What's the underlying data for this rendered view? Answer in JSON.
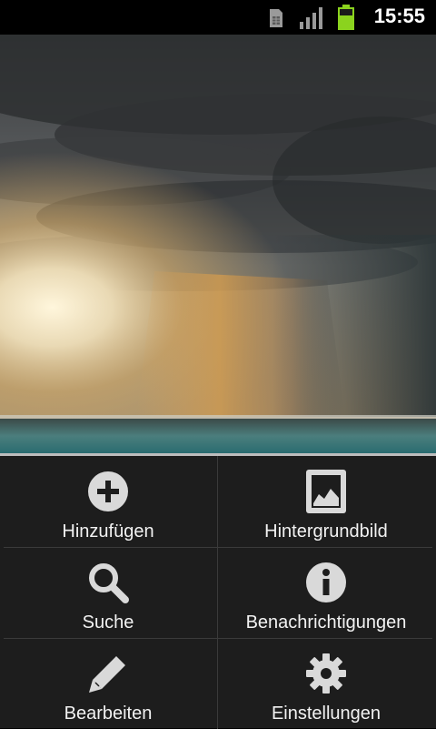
{
  "status_bar": {
    "time": "15:55",
    "icons": [
      "sim-card-icon",
      "signal-strength-icon",
      "battery-charging-icon"
    ],
    "battery_color": "#8bd31e"
  },
  "wallpaper": {
    "description_icon": "storm-clouds-sea-wallpaper"
  },
  "menu": {
    "items": [
      {
        "label": "Hinzufügen",
        "icon": "add-icon"
      },
      {
        "label": "Hintergrundbild",
        "icon": "wallpaper-icon"
      },
      {
        "label": "Suche",
        "icon": "search-icon"
      },
      {
        "label": "Benachrichtigungen",
        "icon": "info-icon"
      },
      {
        "label": "Bearbeiten",
        "icon": "edit-icon"
      },
      {
        "label": "Einstellungen",
        "icon": "settings-icon"
      }
    ]
  }
}
